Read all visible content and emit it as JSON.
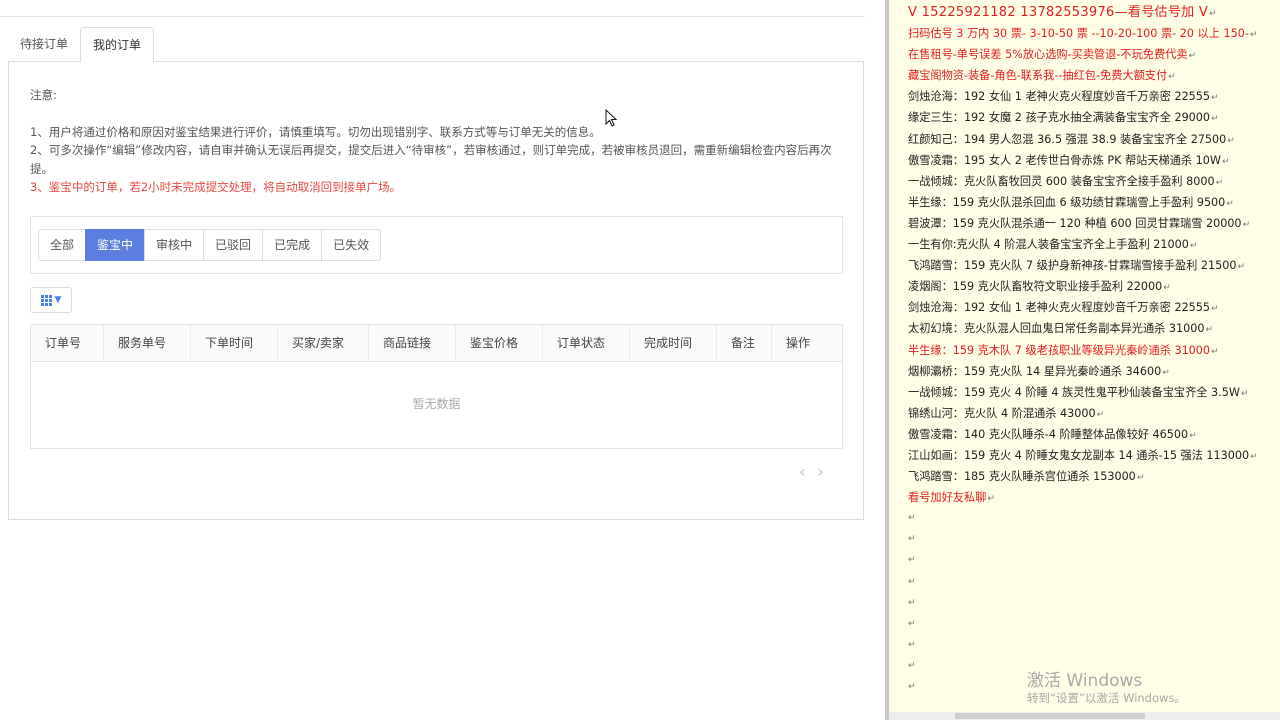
{
  "tabs": [
    "待接订单",
    "我的订单"
  ],
  "notice": {
    "title": "注意:",
    "line1": "1、用户将通过价格和原因对鉴宝结果进行评价，请慎重填写。切勿出现错别字、联系方式等与订单无关的信息。",
    "line2": "2、可多次操作“编辑”修改内容，请自审并确认无误后再提交，提交后进入“待审核”，若审核通过，则订单完成，若被审核员退回，需重新编辑检查内容后再次提。",
    "line3": "3、鉴宝中的订单，若2小时未完成提交处理，将自动取消回到接单广场。"
  },
  "filters": [
    "全部",
    "鉴宝中",
    "审核中",
    "已驳回",
    "已完成",
    "已失效"
  ],
  "active_filter": "鉴宝中",
  "table": {
    "headers": [
      "订单号",
      "服务单号",
      "下单时间",
      "买家/卖家",
      "商品链接",
      "鉴宝价格",
      "订单状态",
      "完成时间",
      "备注",
      "操作"
    ],
    "empty_text": "暂无数据"
  },
  "pager": {
    "prev": "‹",
    "next": "›"
  },
  "doc": {
    "lines": [
      {
        "text": "V 15225921182      13782553976—看号估号加 V",
        "style": "red big"
      },
      {
        "text": "扫码估号 3 万内 30 票- 3-10-50 票  --10-20-100 票- 20 以上 150-",
        "style": "red"
      },
      {
        "text": "在售租号-单号误差 5%放心选购-买卖管退-不玩免费代卖",
        "style": "red"
      },
      {
        "text": "藏宝阁物资-装备-角色-联系我--抽红包-免费大额支付",
        "style": "red"
      },
      {
        "text": "剑烛沧海：192 女仙 1 老神火克火程度妙音千万亲密 22555",
        "style": ""
      },
      {
        "text": "缘定三生：192 女魔 2 孩子克水抽全满装备宝宝齐全 29000",
        "style": ""
      },
      {
        "text": "红颜知己：194 男人忽混 36.5 强混 38.9 装备宝宝齐全 27500",
        "style": ""
      },
      {
        "text": "傲雪凌霜：195 女人 2 老传世白骨赤炼 PK 帮站天梯通杀 10W",
        "style": ""
      },
      {
        "text": "一战倾城：克火队畜牧回灵 600 装备宝宝齐全接手盈利 8000",
        "style": ""
      },
      {
        "text": "半生缘：159 克火队混杀回血 6 级功绩甘霖瑞雪上手盈利 9500",
        "style": ""
      },
      {
        "text": "碧波潭：159 克火队混杀通一 120 种植 600 回灵甘霖瑞雪 20000",
        "style": ""
      },
      {
        "text": "一生有你:克火队 4 阶混人装备宝宝齐全上手盈利 21000",
        "style": ""
      },
      {
        "text": "飞鸿踏雪：159 克火队 7 级护身新神孩-甘霖瑞雪接手盈利 21500",
        "style": ""
      },
      {
        "text": "凌烟阁：159 克火队畜牧符文职业接手盈利 22000",
        "style": ""
      },
      {
        "text": "剑烛沧海：192 女仙 1 老神火克火程度妙音千万亲密 22555",
        "style": ""
      },
      {
        "text": "太初幻境：克火队混人回血鬼日常任务副本异光通杀 31000",
        "style": ""
      },
      {
        "text": "半生缘：159 克木队 7 级老孩职业等级异光秦岭通杀 31000",
        "style": "red"
      },
      {
        "text": "烟柳灞桥：159 克火队 14 星异光秦岭通杀 34600",
        "style": ""
      },
      {
        "text": "一战倾城：159 克火 4 阶睡 4 族灵性鬼平秒仙装备宝宝齐全 3.5W",
        "style": ""
      },
      {
        "text": "锦绣山河：克火队 4 阶混通杀 43000",
        "style": ""
      },
      {
        "text": "傲雪凌霜：140 克火队睡杀-4 阶睡整体品像较好 46500",
        "style": ""
      },
      {
        "text": "江山如画：159 克火 4 阶睡女鬼女龙副本 14 通杀-15 强法 113000",
        "style": ""
      },
      {
        "text": "飞鸿踏雪：185 克火队睡杀宫位通杀 153000",
        "style": ""
      },
      {
        "text": "看号加好友私聊",
        "style": "red"
      }
    ],
    "para_mark": "↵",
    "empty_paragraphs": 9
  },
  "watermark": {
    "title": "激活 Windows",
    "subtitle": "转到“设置”以激活 Windows。"
  },
  "colors": {
    "accent": "#5b7fe0",
    "red": "#e02020",
    "doc_bg": "#fffde6"
  }
}
